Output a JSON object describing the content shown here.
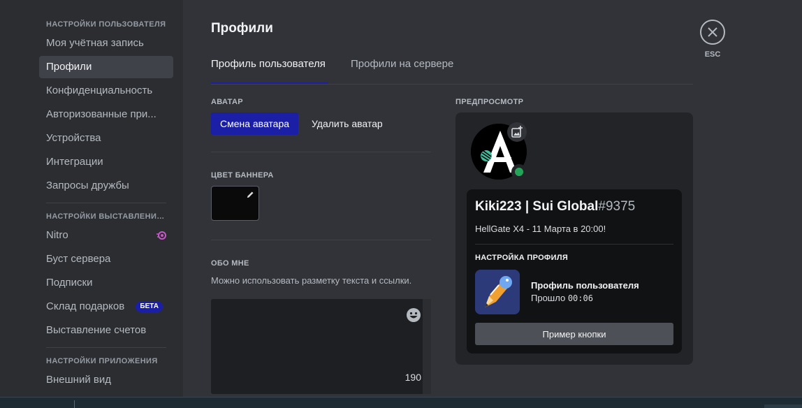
{
  "sidebar": {
    "user_settings_header": "НАСТРОЙКИ ПОЛЬЗОВАТЕЛЯ",
    "user_items": [
      {
        "label": "Моя учётная запись"
      },
      {
        "label": "Профили"
      },
      {
        "label": "Конфиденциальность"
      },
      {
        "label": "Авторизованные при..."
      },
      {
        "label": "Устройства"
      },
      {
        "label": "Интеграции"
      },
      {
        "label": "Запросы дружбы"
      }
    ],
    "billing_header": "НАСТРОЙКИ ВЫСТАВЛЕНИЯ ...",
    "billing_items": [
      {
        "label": "Nitro"
      },
      {
        "label": "Буст сервера"
      },
      {
        "label": "Подписки"
      },
      {
        "label": "Склад подарков",
        "badge": "БЕТА"
      },
      {
        "label": "Выставление счетов"
      }
    ],
    "app_header": "НАСТРОЙКИ ПРИЛОЖЕНИЯ",
    "app_items": [
      {
        "label": "Внешний вид"
      }
    ],
    "active_item": "Профили"
  },
  "main": {
    "title": "Профили",
    "tabs": [
      {
        "label": "Профиль пользователя",
        "active": true
      },
      {
        "label": "Профили на сервере",
        "active": false
      }
    ],
    "avatar": {
      "label": "АВАТАР",
      "change_button": "Смена аватара",
      "remove_button": "Удалить аватар"
    },
    "banner": {
      "label": "ЦВЕТ БАННЕРА",
      "color": "#0a0a0a"
    },
    "about": {
      "label": "ОБО МНЕ",
      "hint": "Можно использовать разметку текста и ссылки.",
      "value": "",
      "remaining": "190"
    }
  },
  "preview": {
    "label": "ПРЕДПРОСМОТР",
    "username": "Kiki223 | Sui Global",
    "discriminator": "#9375",
    "custom_status": "HellGate X4 - 11 Марта в 20:00!",
    "activity_header": "НАСТРОЙКА ПРОФИЛЯ",
    "activity_title": "Профиль пользователя",
    "activity_elapsed_prefix": "Прошло",
    "activity_elapsed": "00:06",
    "sample_button": "Пример кнопки",
    "status": "online"
  },
  "close": {
    "label": "ESC"
  },
  "colors": {
    "accent": "#1a1fa6",
    "online": "#23a559",
    "background": "#313338",
    "sidebar": "#2b2d31"
  }
}
